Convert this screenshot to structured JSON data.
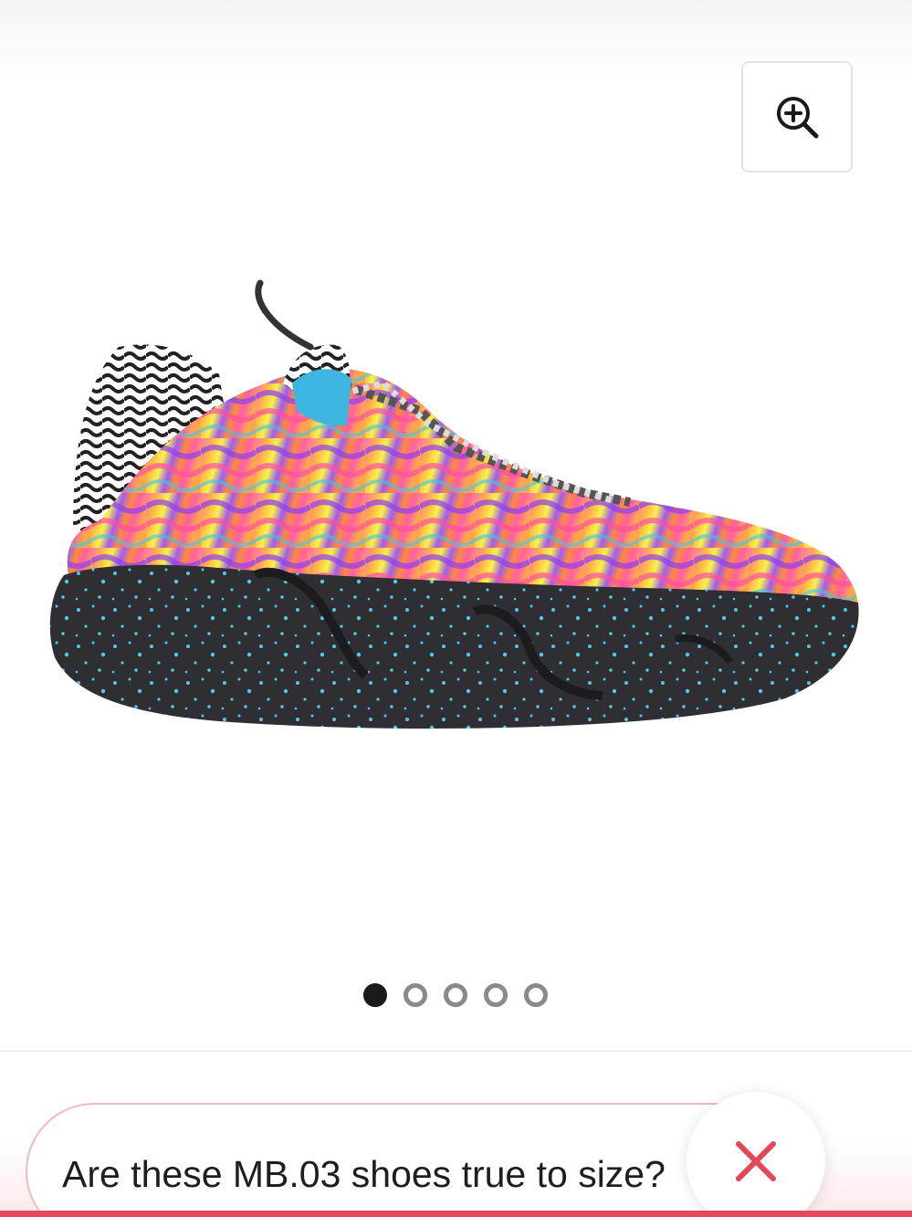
{
  "product": {
    "image_alt": "MB.03 shoe"
  },
  "carousel": {
    "slide_count": 5,
    "active_index": 0
  },
  "zoom": {
    "icon": "zoom-in-icon"
  },
  "chat": {
    "question": "Are these MB.03 shoes true to size?",
    "close_icon": "close-icon",
    "accent_color": "#e5475a"
  }
}
